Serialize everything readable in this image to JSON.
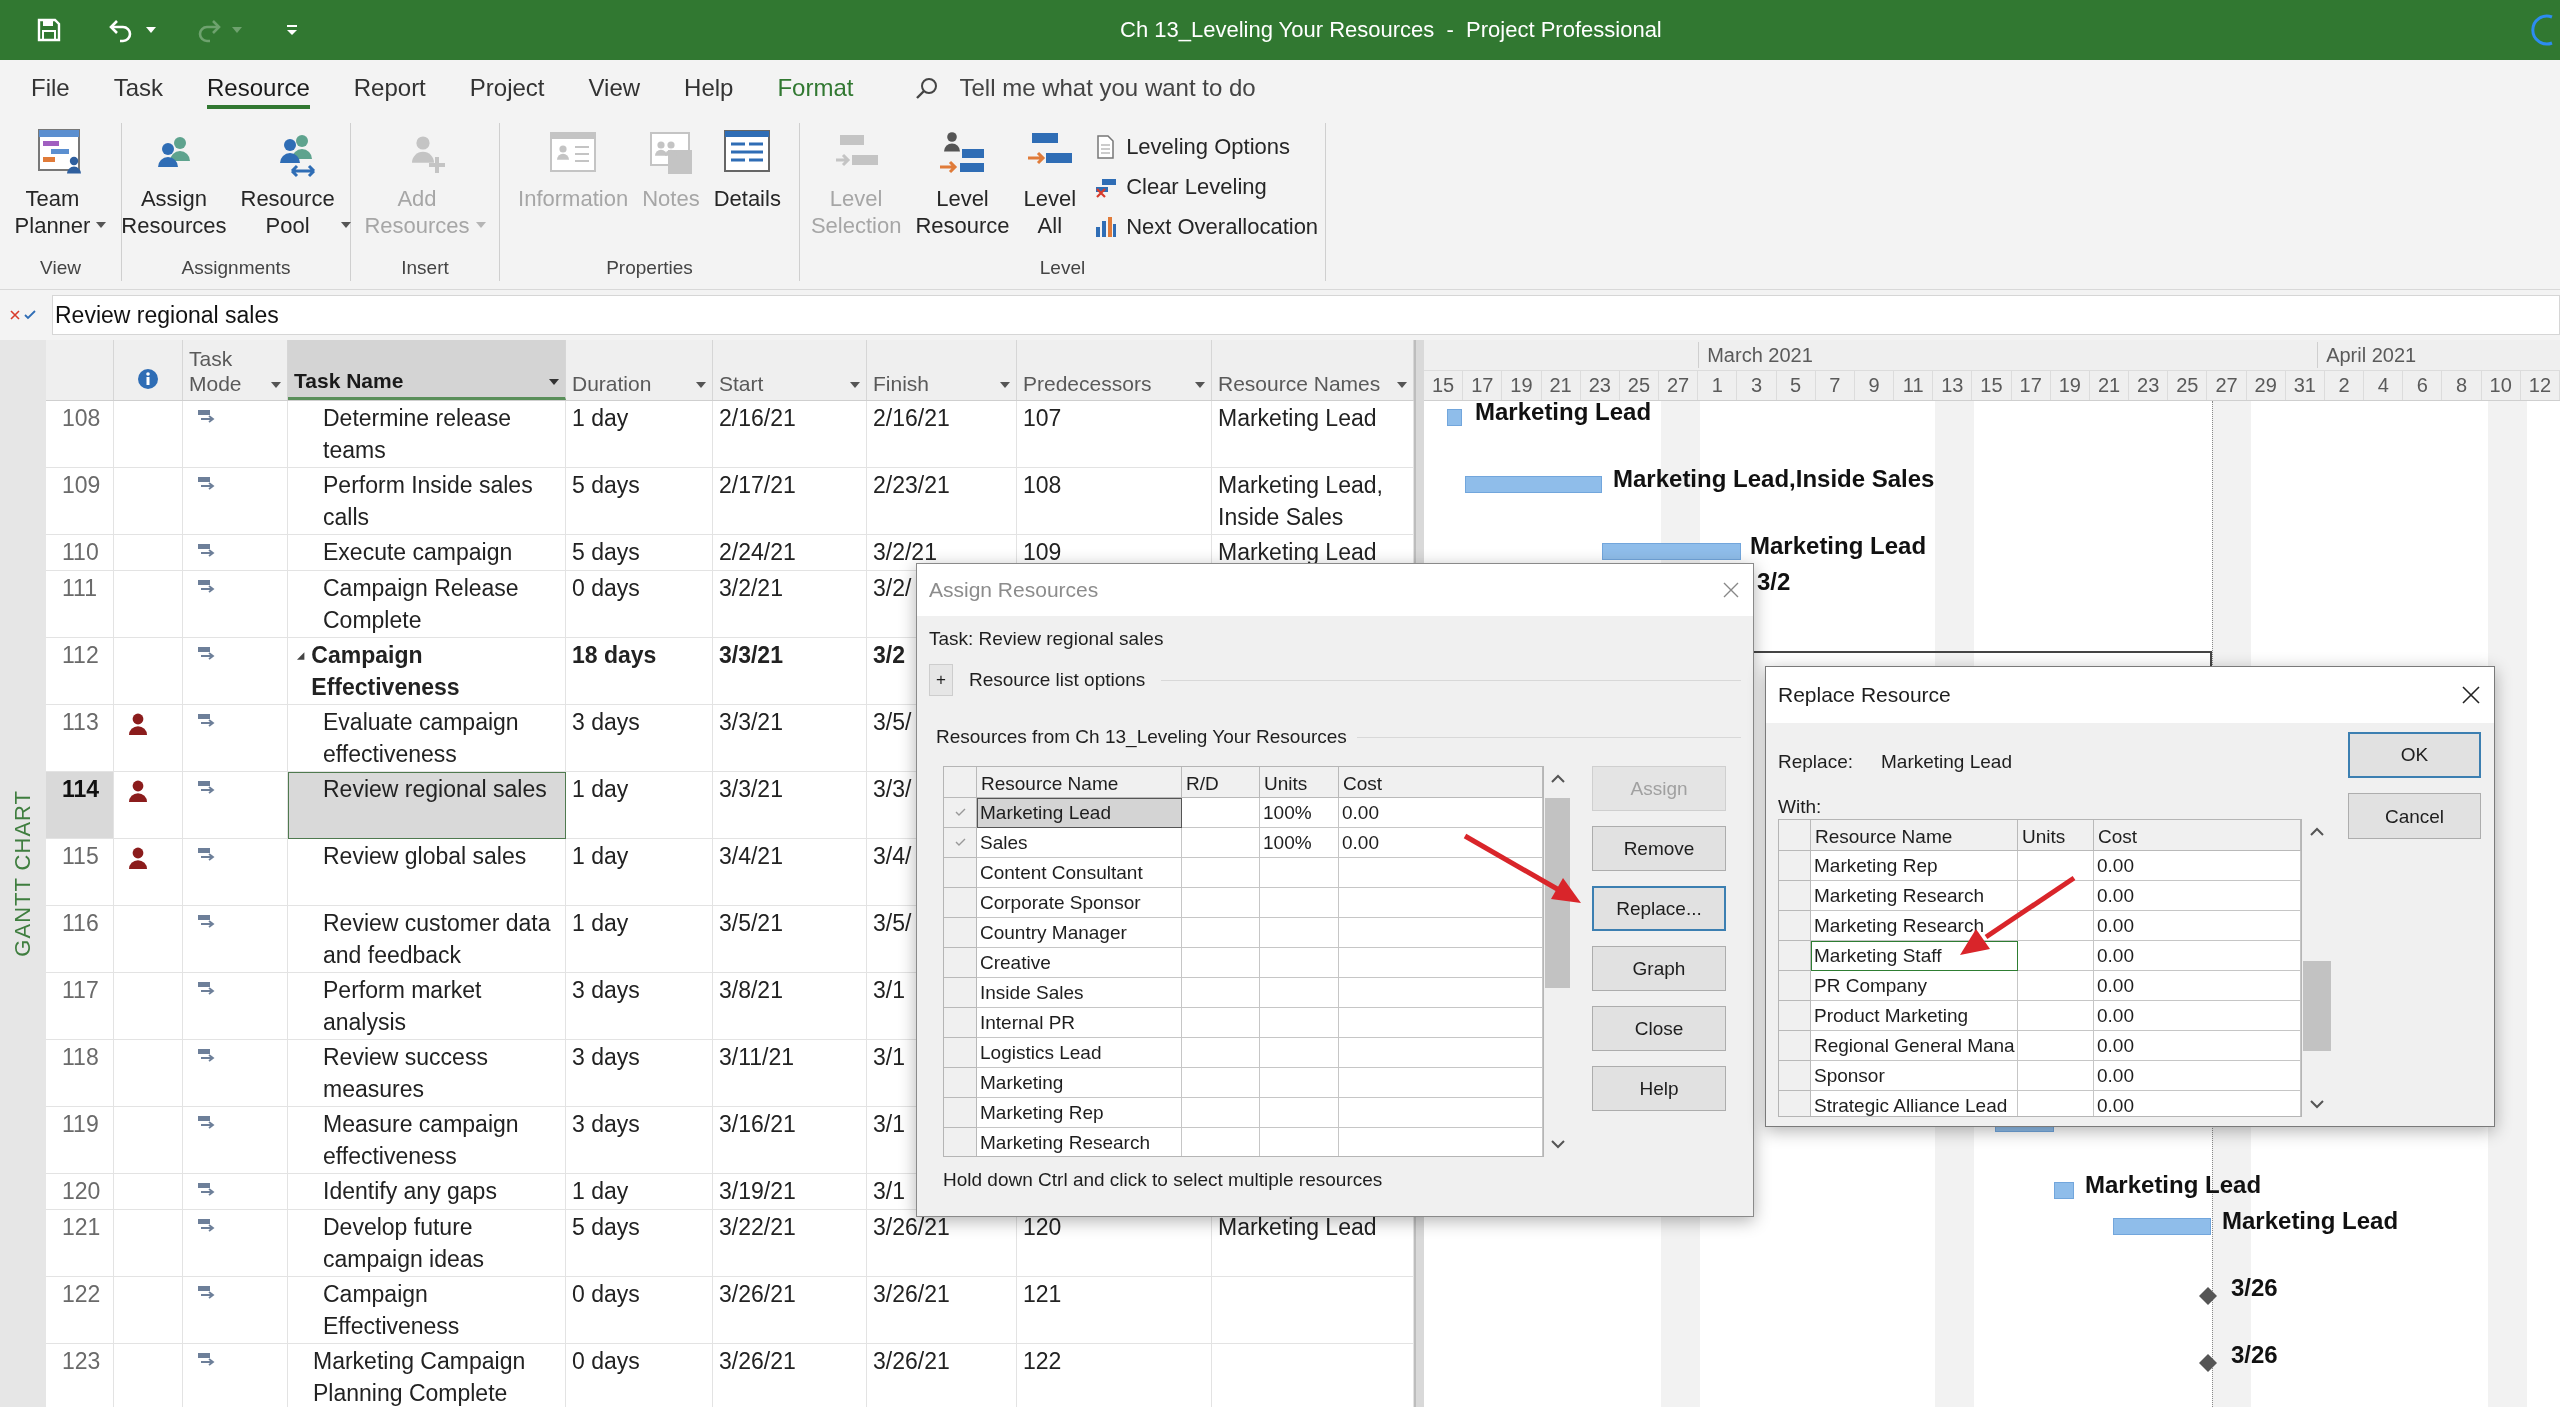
{
  "window": {
    "title": "Ch 13_Leveling Your Resources  -  Project Professional"
  },
  "ribbon_tabs": [
    {
      "label": "File",
      "selected": false,
      "kind": "normal"
    },
    {
      "label": "Task",
      "selected": false,
      "kind": "normal"
    },
    {
      "label": "Resource",
      "selected": true,
      "kind": "normal"
    },
    {
      "label": "Report",
      "selected": false,
      "kind": "normal"
    },
    {
      "label": "Project",
      "selected": false,
      "kind": "normal"
    },
    {
      "label": "View",
      "selected": false,
      "kind": "normal"
    },
    {
      "label": "Help",
      "selected": false,
      "kind": "normal"
    },
    {
      "label": "Format",
      "selected": false,
      "kind": "contextual"
    }
  ],
  "tell_me": {
    "placeholder": "Tell me what you want to do"
  },
  "ribbon_groups": [
    {
      "label": "View",
      "commands": [
        {
          "label": "Team Planner",
          "kind": "large",
          "dropdown": true,
          "disabled": false
        }
      ]
    },
    {
      "label": "Assignments",
      "commands": [
        {
          "label": "Assign Resources",
          "kind": "large",
          "dropdown": false,
          "disabled": false
        },
        {
          "label": "Resource Pool",
          "kind": "large",
          "dropdown": true,
          "disabled": false
        }
      ]
    },
    {
      "label": "Insert",
      "commands": [
        {
          "label": "Add Resources",
          "kind": "large",
          "dropdown": true,
          "disabled": true
        }
      ]
    },
    {
      "label": "Properties",
      "commands": [
        {
          "label": "Information",
          "kind": "large",
          "dropdown": false,
          "disabled": true
        },
        {
          "label": "Notes",
          "kind": "large",
          "dropdown": false,
          "disabled": true
        },
        {
          "label": "Details",
          "kind": "large",
          "dropdown": false,
          "disabled": false
        }
      ]
    },
    {
      "label": "Level",
      "commands": [
        {
          "label": "Level Selection",
          "kind": "large",
          "dropdown": false,
          "disabled": true
        },
        {
          "label": "Level Resource",
          "kind": "large",
          "dropdown": false,
          "disabled": false
        },
        {
          "label": "Level All",
          "kind": "large",
          "dropdown": false,
          "disabled": false
        },
        {
          "label": "Leveling Options",
          "kind": "small",
          "dropdown": false,
          "disabled": false
        },
        {
          "label": "Clear Leveling",
          "kind": "small",
          "dropdown": false,
          "disabled": false
        },
        {
          "label": "Next Overallocation",
          "kind": "small",
          "dropdown": false,
          "disabled": false
        }
      ]
    }
  ],
  "entry_bar": {
    "value": "Review regional sales"
  },
  "side_label": "GANTT CHART",
  "table": {
    "columns": [
      {
        "label": "Task Mode",
        "selected": false
      },
      {
        "label": "Task Name",
        "selected": true
      },
      {
        "label": "Duration",
        "selected": false
      },
      {
        "label": "Start",
        "selected": false
      },
      {
        "label": "Finish",
        "selected": false
      },
      {
        "label": "Predecessors",
        "selected": false
      },
      {
        "label": "Resource Names",
        "selected": false
      }
    ]
  },
  "timescale": {
    "months": [
      "March 2021",
      "April 2021"
    ],
    "days": [
      "15",
      "17",
      "19",
      "21",
      "23",
      "25",
      "27",
      "1",
      "3",
      "5",
      "7",
      "9",
      "11",
      "13",
      "15",
      "17",
      "19",
      "21",
      "23",
      "25",
      "27",
      "29",
      "31",
      "2",
      "4",
      "6",
      "8",
      "10",
      "12"
    ]
  },
  "rows": [
    {
      "kind": "continued",
      "children": [
        {
          "id": "108",
          "kind": "task",
          "overallocated": false,
          "selected": false,
          "name": "Determine release teams",
          "duration": "1 day",
          "start": "2/16/21",
          "finish": "2/16/21",
          "predecessors": "107",
          "resources": "Marketing Lead",
          "gantt_label": "Marketing Lead"
        },
        {
          "id": "109",
          "kind": "task",
          "overallocated": false,
          "selected": false,
          "name": "Perform Inside sales calls",
          "duration": "5 days",
          "start": "2/17/21",
          "finish": "2/23/21",
          "predecessors": "108",
          "resources": "Marketing Lead, Inside Sales",
          "gantt_label": "Marketing Lead,Inside Sales"
        },
        {
          "id": "110",
          "kind": "task",
          "overallocated": false,
          "selected": false,
          "name": "Execute campaign",
          "duration": "5 days",
          "start": "2/24/21",
          "finish": "3/2/21",
          "predecessors": "109",
          "resources": "Marketing Lead",
          "gantt_label": "Marketing Lead"
        },
        {
          "id": "111",
          "kind": "milestone",
          "overallocated": false,
          "selected": false,
          "name": "Campaign Release Complete",
          "duration": "0 days",
          "start": "3/2/21",
          "finish": "3/2/",
          "gantt_label": "3/2"
        }
      ]
    },
    {
      "id": "112",
      "kind": "summary",
      "expanded": true,
      "overallocated": false,
      "selected": false,
      "name": "Campaign Effectiveness",
      "duration": "18 days",
      "start": "3/3/21",
      "finish": "3/2",
      "children": [
        {
          "id": "113",
          "kind": "task",
          "overallocated": true,
          "selected": false,
          "name": "Evaluate campaign effectiveness",
          "duration": "3 days",
          "start": "3/3/21",
          "finish": "3/5/"
        },
        {
          "id": "114",
          "kind": "task",
          "overallocated": true,
          "selected": true,
          "name": "Review regional sales",
          "duration": "1 day",
          "start": "3/3/21",
          "finish": "3/3/"
        },
        {
          "id": "115",
          "kind": "task",
          "overallocated": true,
          "selected": false,
          "name": "Review global sales",
          "duration": "1 day",
          "start": "3/4/21",
          "finish": "3/4/"
        },
        {
          "id": "116",
          "kind": "task",
          "overallocated": false,
          "selected": false,
          "name": "Review customer data and feedback",
          "duration": "1 day",
          "start": "3/5/21",
          "finish": "3/5/"
        },
        {
          "id": "117",
          "kind": "task",
          "overallocated": false,
          "selected": false,
          "name": "Perform market analysis",
          "duration": "3 days",
          "start": "3/8/21",
          "finish": "3/1"
        },
        {
          "id": "118",
          "kind": "task",
          "overallocated": false,
          "selected": false,
          "name": "Review success measures",
          "duration": "3 days",
          "start": "3/11/21",
          "finish": "3/1"
        },
        {
          "id": "119",
          "kind": "task",
          "overallocated": false,
          "selected": false,
          "name": "Measure campaign effectiveness",
          "duration": "3 days",
          "start": "3/16/21",
          "finish": "3/1"
        },
        {
          "id": "120",
          "kind": "task",
          "overallocated": false,
          "selected": false,
          "name": "Identify any gaps",
          "duration": "1 day",
          "start": "3/19/21",
          "finish": "3/1",
          "gantt_label": "Marketing Lead"
        },
        {
          "id": "121",
          "kind": "task",
          "overallocated": false,
          "selected": false,
          "name": "Develop future campaign ideas",
          "duration": "5 days",
          "start": "3/22/21",
          "finish": "3/26/21",
          "predecessors": "120",
          "resources": "Marketing Lead",
          "gantt_label": "Marketing Lead"
        },
        {
          "id": "122",
          "kind": "milestone",
          "overallocated": false,
          "selected": false,
          "name": "Campaign Effectiveness",
          "duration": "0 days",
          "start": "3/26/21",
          "finish": "3/26/21",
          "predecessors": "121",
          "gantt_label": "3/26"
        }
      ]
    },
    {
      "id": "123",
      "kind": "milestone",
      "overallocated": false,
      "selected": false,
      "name": "Marketing Campaign Planning Complete",
      "duration": "0 days",
      "start": "3/26/21",
      "finish": "3/26/21",
      "predecessors": "122",
      "gantt_label": "3/26"
    }
  ],
  "assign_dialog": {
    "title": "Assign Resources",
    "task": "Task: Review regional sales",
    "options_button": "+",
    "options_label": "Resource list options",
    "list_title": "Resources from Ch 13_Leveling Your Resources",
    "columns": [
      "Resource Name",
      "R/D",
      "Units",
      "Cost"
    ],
    "resources": [
      {
        "name": "Marketing Lead",
        "assigned": true,
        "units": "100%",
        "cost": "0.00",
        "selected": true
      },
      {
        "name": "Sales",
        "assigned": true,
        "units": "100%",
        "cost": "0.00",
        "selected": false
      },
      {
        "name": "Content Consultant",
        "assigned": false,
        "selected": false
      },
      {
        "name": "Corporate Sponsor",
        "assigned": false,
        "selected": false
      },
      {
        "name": "Country Manager",
        "assigned": false,
        "selected": false
      },
      {
        "name": "Creative",
        "assigned": false,
        "selected": false
      },
      {
        "name": "Inside Sales",
        "assigned": false,
        "selected": false
      },
      {
        "name": "Internal PR",
        "assigned": false,
        "selected": false
      },
      {
        "name": "Logistics Lead",
        "assigned": false,
        "selected": false
      },
      {
        "name": "Marketing",
        "assigned": false,
        "selected": false
      },
      {
        "name": "Marketing Rep",
        "assigned": false,
        "selected": false
      },
      {
        "name": "Marketing Research",
        "assigned": false,
        "selected": false
      }
    ],
    "buttons": [
      {
        "label": "Assign",
        "disabled": true,
        "focused": false
      },
      {
        "label": "Remove",
        "disabled": false,
        "focused": false
      },
      {
        "label": "Replace...",
        "disabled": false,
        "focused": true
      },
      {
        "label": "Graph",
        "disabled": false,
        "focused": false
      },
      {
        "label": "Close",
        "disabled": false,
        "focused": false
      },
      {
        "label": "Help",
        "disabled": false,
        "focused": false
      }
    ],
    "hint": "Hold down Ctrl and click to select multiple resources"
  },
  "replace_dialog": {
    "title": "Replace Resource",
    "replace_label": "Replace:",
    "replace_value": "Marketing Lead",
    "with_label": "With:",
    "columns": [
      "Resource Name",
      "Units",
      "Cost"
    ],
    "resources": [
      {
        "name": "Marketing Rep",
        "cost": "0.00",
        "selected": false
      },
      {
        "name": "Marketing Research",
        "cost": "0.00",
        "selected": false
      },
      {
        "name": "Marketing Research",
        "cost": "0.00",
        "selected": false
      },
      {
        "name": "Marketing Staff",
        "cost": "0.00",
        "selected": true
      },
      {
        "name": "PR Company",
        "cost": "0.00",
        "selected": false
      },
      {
        "name": "Product Marketing",
        "cost": "0.00",
        "selected": false
      },
      {
        "name": "Regional General Mana",
        "cost": "0.00",
        "selected": false
      },
      {
        "name": "Sponsor",
        "cost": "0.00",
        "selected": false
      },
      {
        "name": "Strategic Alliance Lead",
        "cost": "0.00",
        "selected": false
      }
    ],
    "buttons": [
      {
        "label": "OK",
        "default": true
      },
      {
        "label": "Cancel",
        "default": false
      }
    ]
  }
}
